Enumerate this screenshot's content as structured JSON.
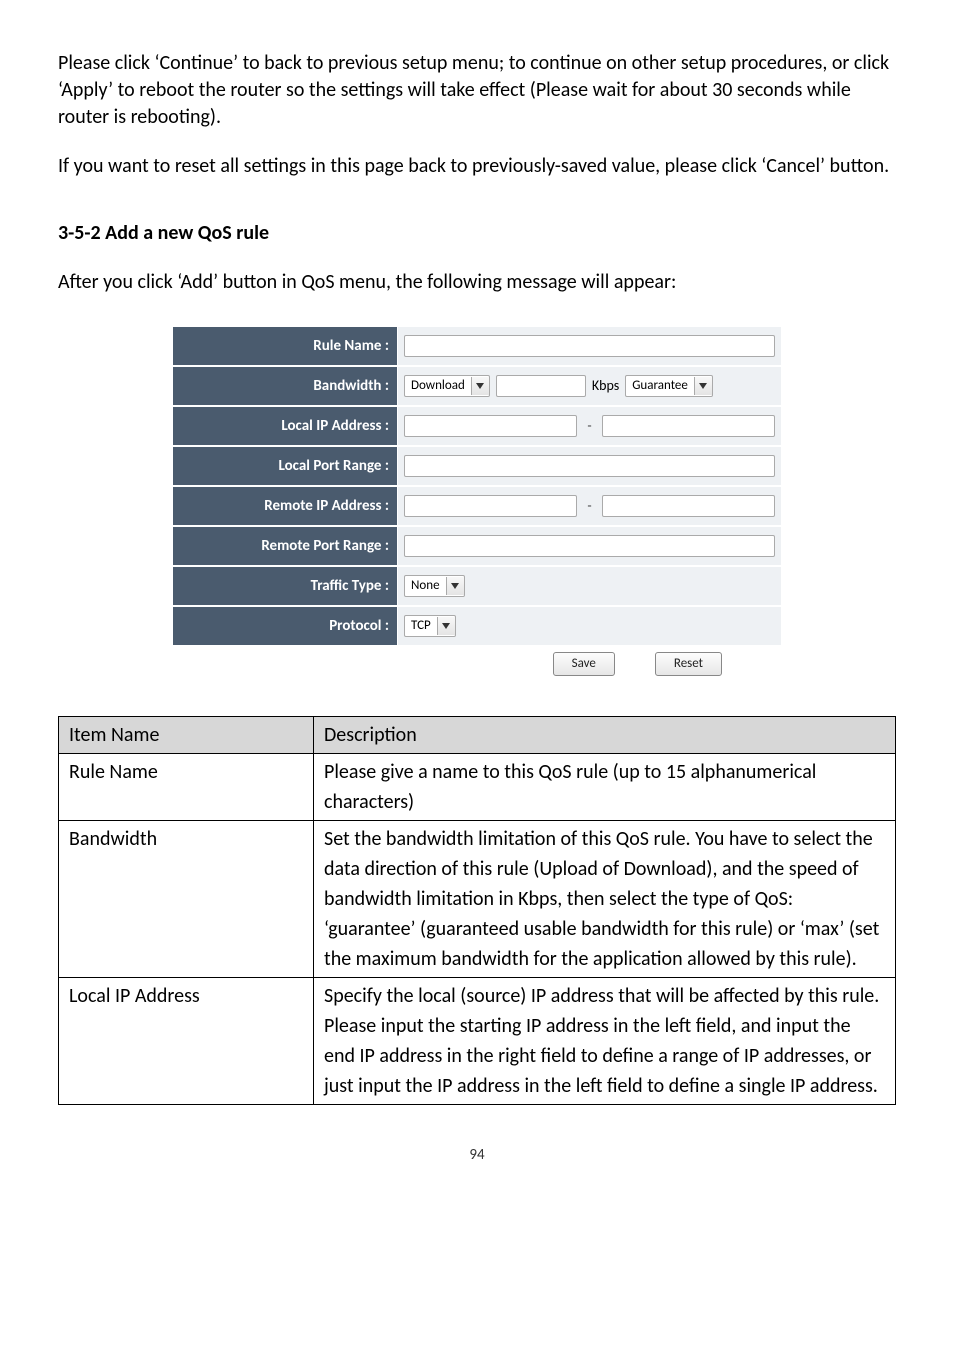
{
  "para1": "Please click ‘Continue’ to back to previous setup menu; to continue on other setup procedures, or click ‘Apply’ to reboot the router so the settings will take effect (Please wait for about 30 seconds while router is rebooting).",
  "para2": "If you want to reset all settings in this page back to previously-saved value, please click ‘Cancel’ button.",
  "heading": "3-5-2 Add a new QoS rule",
  "para3": "After you click ‘Add’ button in QoS menu, the following message will appear:",
  "form": {
    "labels": {
      "rule_name": "Rule Name :",
      "bandwidth": "Bandwidth :",
      "local_ip": "Local IP Address :",
      "local_port": "Local Port Range :",
      "remote_ip": "Remote IP Address :",
      "remote_port": "Remote Port Range :",
      "traffic_type": "Traffic Type :",
      "protocol": "Protocol :"
    },
    "values": {
      "bandwidth_dir": "Download",
      "bandwidth_unit": "Kbps",
      "bandwidth_mode": "Guarantee",
      "traffic_type": "None",
      "protocol": "TCP",
      "range_sep": "-"
    },
    "buttons": {
      "save": "Save",
      "reset": "Reset"
    }
  },
  "table": {
    "headers": {
      "item": "Item Name",
      "desc": "Description"
    },
    "rows": [
      {
        "item": "Rule Name",
        "desc": "Please give a name to this QoS rule (up to 15 alphanumerical characters)"
      },
      {
        "item": "Bandwidth",
        "desc": "Set the bandwidth limitation of this QoS rule. You have to select the data direction of this rule (Upload of Download), and the speed of bandwidth limitation in Kbps, then select the type of QoS: ‘guarantee’ (guaranteed usable bandwidth for this rule) or ‘max’ (set the maximum bandwidth for the application allowed by this rule)."
      },
      {
        "item": "Local IP Address",
        "desc": "Specify the local (source) IP address that will be affected by this rule. Please input the starting IP address in the left field, and input the end IP address in the right field to define a range of IP addresses, or just input the IP address in the left field to define a single IP address."
      }
    ]
  },
  "page_number": "94"
}
